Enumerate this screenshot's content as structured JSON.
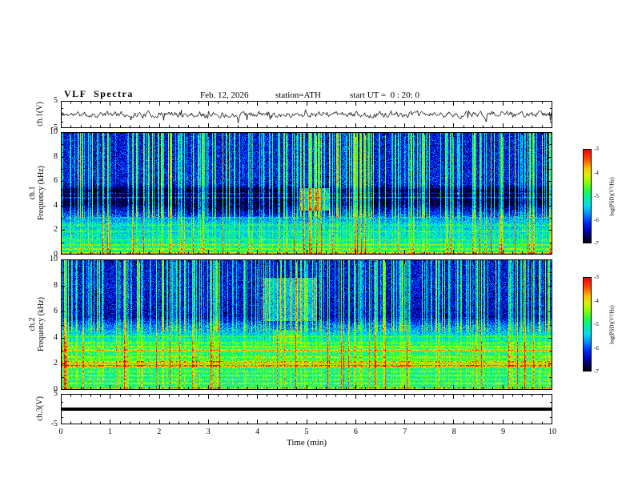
{
  "header": {
    "title": "VLF  Spectra",
    "date": "Feb. 12, 2026",
    "station": "station=ATH",
    "start_ut": "start UT =  0 : 20: 0"
  },
  "axes": {
    "x_label": "Time (min)",
    "x_ticks": [
      "0",
      "1",
      "2",
      "3",
      "4",
      "5",
      "6",
      "7",
      "8",
      "9",
      "10"
    ],
    "x_range_min": [
      0,
      10
    ]
  },
  "panels": {
    "ch1_wave": {
      "ylabel": "ch.1(V)",
      "ymax_label": "5",
      "ymin_label": "-5",
      "y_range": [
        -5,
        5
      ]
    },
    "ch1_spec": {
      "ylabel_line1": "ch.1",
      "ylabel_line2": "Frequency (kHz)",
      "ytick_labels": [
        "10",
        "8",
        "6",
        "4",
        "2",
        "0"
      ],
      "ytick_values": [
        10,
        8,
        6,
        4,
        2,
        0
      ]
    },
    "ch2_spec": {
      "ylabel_line1": "ch.2",
      "ylabel_line2": "Frequency (kHz)",
      "ytick_labels": [
        "10",
        "8",
        "6",
        "4",
        "2",
        "0"
      ],
      "ytick_values": [
        10,
        8,
        6,
        4,
        2,
        0
      ]
    },
    "ch3_wave": {
      "ylabel": "ch.3(V)",
      "ymax_label": "5",
      "ymin_label": "-5",
      "y_range": [
        -5,
        5
      ]
    }
  },
  "colorbar": {
    "label": "log(PSD)(V²/Hz)",
    "tick_labels": [
      "-3",
      "-4",
      "-5",
      "-6",
      "-7"
    ],
    "z_range": [
      -7,
      -3
    ],
    "stops": [
      [
        -7.0,
        "#000006"
      ],
      [
        -6.75,
        "#00004a"
      ],
      [
        -6.45,
        "#0000c0"
      ],
      [
        -6.1,
        "#0030ff"
      ],
      [
        -5.75,
        "#0090ff"
      ],
      [
        -5.4,
        "#00e0f0"
      ],
      [
        -5.05,
        "#00f0a0"
      ],
      [
        -4.75,
        "#20ff40"
      ],
      [
        -4.45,
        "#80ff00"
      ],
      [
        -4.1,
        "#e0f000"
      ],
      [
        -3.8,
        "#ffc000"
      ],
      [
        -3.5,
        "#ff6000"
      ],
      [
        -3.15,
        "#ff1000"
      ],
      [
        -3.0,
        "#ff0000"
      ]
    ]
  },
  "chart_data": [
    {
      "type": "line",
      "name": "ch1-waveform",
      "xlabel": "Time (min)",
      "ylabel": "ch.1(V)",
      "x_range_min": [
        0,
        10
      ],
      "y_range": [
        -5,
        5
      ],
      "y_mean": 0,
      "noise_amplitude_V": 0.9,
      "spike_amplitude_V": 2.6,
      "color": "#000000",
      "seed": 11,
      "description": "continuous broadband noise trace centered on 0 V with intermittent impulsive spikes"
    },
    {
      "type": "heatmap",
      "name": "ch1-spectrogram",
      "xlabel": "Time (min)",
      "ylabel": "ch.1 Frequency (kHz)",
      "x_range_min": [
        0,
        10
      ],
      "freq_range_kHz": [
        0,
        10
      ],
      "z_label": "log(PSD)(V²/Hz)",
      "z_range": [
        -7,
        -3
      ],
      "base_profile": [
        [
          0,
          -4.8
        ],
        [
          0.4,
          -5.1
        ],
        [
          1.5,
          -5.3
        ],
        [
          2.6,
          -5.5
        ],
        [
          3.2,
          -6.0
        ],
        [
          3.8,
          -6.5
        ],
        [
          4.1,
          -6.85
        ],
        [
          5.3,
          -6.9
        ],
        [
          5.7,
          -6.3
        ],
        [
          6.3,
          -6.25
        ],
        [
          10,
          -6.3
        ]
      ],
      "horizontal_lines": [
        {
          "f": 0.12,
          "amp": 1.5,
          "w": 0.05
        },
        {
          "f": 0.45,
          "amp": 0.9
        },
        {
          "f": 0.8,
          "amp": 0.7
        },
        {
          "f": 1.2,
          "amp": 0.5
        },
        {
          "f": 1.9,
          "amp": 0.5
        },
        {
          "f": 2.4,
          "amp": 0.4
        },
        {
          "f": 3.0,
          "amp": 0.35
        },
        {
          "f": 4.65,
          "amp": 0.9,
          "w": 0.05
        },
        {
          "f": 5.0,
          "amp": 0.4
        }
      ],
      "vertical_streaks": {
        "count": 260,
        "min_amp": 0.5,
        "max_amp": 2.2,
        "min_freq_kHz": 3.0,
        "full_height_prob": 0.3
      },
      "patches": [
        {
          "t": [
            4.85,
            5.45
          ],
          "f": [
            3.6,
            5.4
          ],
          "amp": 1.35
        },
        {
          "t": [
            2.3,
            4.6
          ],
          "f": [
            3.1,
            4.0
          ],
          "amp": -0.25
        }
      ],
      "noise_sigma": 0.35,
      "seed": 42,
      "description": "blue background above 5.5 kHz with dense vertical sferic streaks; dark quiet band 4-5.4 kHz; cyan band 1-3 kHz; bright green/yellow narrow lines below 1 kHz"
    },
    {
      "type": "heatmap",
      "name": "ch2-spectrogram",
      "xlabel": "Time (min)",
      "ylabel": "ch.2 Frequency (kHz)",
      "x_range_min": [
        0,
        10
      ],
      "freq_range_kHz": [
        0,
        10
      ],
      "z_label": "log(PSD)(V²/Hz)",
      "z_range": [
        -7,
        -3
      ],
      "base_profile": [
        [
          0,
          -4.9
        ],
        [
          0.4,
          -5.1
        ],
        [
          1.3,
          -5.1
        ],
        [
          1.8,
          -4.9
        ],
        [
          2.3,
          -4.9
        ],
        [
          3.5,
          -5.0
        ],
        [
          4.2,
          -5.4
        ],
        [
          5.0,
          -5.9
        ],
        [
          5.6,
          -6.5
        ],
        [
          6.2,
          -6.4
        ],
        [
          8,
          -6.3
        ],
        [
          10,
          -6.35
        ]
      ],
      "horizontal_lines": [
        {
          "f": 0.15,
          "amp": 1.3,
          "w": 0.05
        },
        {
          "f": 0.5,
          "amp": 0.8
        },
        {
          "f": 0.8,
          "amp": 0.6
        },
        {
          "f": 1.1,
          "amp": 0.7
        },
        {
          "f": 1.4,
          "amp": 0.5
        },
        {
          "f": 1.85,
          "amp": 1.3,
          "w": 0.1
        },
        {
          "f": 2.15,
          "amp": 1.1,
          "w": 0.08
        },
        {
          "f": 2.5,
          "amp": 0.7
        },
        {
          "f": 3.05,
          "amp": 1.0,
          "w": 0.07
        },
        {
          "f": 3.3,
          "amp": 0.6
        },
        {
          "f": 3.6,
          "amp": 0.5
        },
        {
          "f": 4.1,
          "amp": 0.5
        }
      ],
      "vertical_streaks": {
        "count": 240,
        "min_amp": 0.5,
        "max_amp": 2.0,
        "min_freq_kHz": 4.5,
        "full_height_prob": 0.25
      },
      "patches": [
        {
          "t": [
            4.1,
            5.2
          ],
          "f": [
            5.3,
            8.6
          ],
          "amp": 0.85
        },
        {
          "t": [
            4.3,
            4.9
          ],
          "f": [
            3.6,
            4.6
          ],
          "amp": 0.5
        }
      ],
      "noise_sigma": 0.35,
      "seed": 77,
      "description": "blue background above 5.5 kHz with vertical sferic streaks; bright green/cyan below 4.5 kHz crossed by strong yellow-orange horizontal lines near 1.9, 2.2 and 3 kHz"
    },
    {
      "type": "line",
      "name": "ch3-waveform",
      "xlabel": "Time (min)",
      "ylabel": "ch.3(V)",
      "x_range_min": [
        0,
        10
      ],
      "y_range": [
        -5,
        5
      ],
      "constant_value": 0,
      "line_width": 4,
      "color": "#000000",
      "description": "flat thick black trace at 0 V (channel off / saturated flat)"
    }
  ]
}
